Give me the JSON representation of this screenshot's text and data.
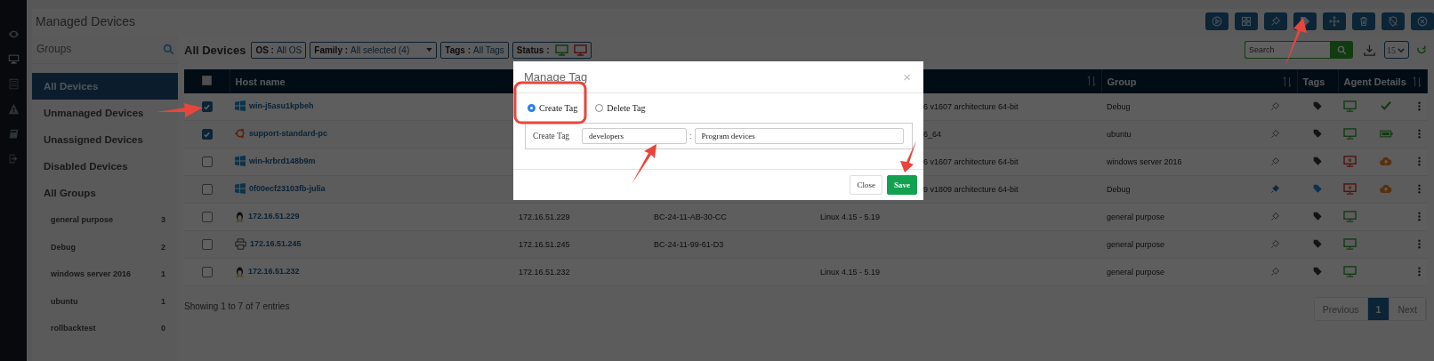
{
  "nav_rail": [
    {
      "kind": "eye",
      "selected": false
    },
    {
      "kind": "monitor",
      "selected": true
    },
    {
      "kind": "list",
      "selected": false
    },
    {
      "kind": "warning",
      "selected": false
    },
    {
      "kind": "book",
      "selected": false
    },
    {
      "kind": "logout",
      "selected": false
    }
  ],
  "page_title": "Managed Devices",
  "toolbar": [
    {
      "kind": "play"
    },
    {
      "kind": "grid"
    },
    {
      "kind": "pin"
    },
    {
      "kind": "tag"
    },
    {
      "kind": "move"
    },
    {
      "kind": "trash"
    },
    {
      "kind": "shield-off"
    },
    {
      "kind": "close-circle"
    }
  ],
  "groups_panel": {
    "title": "Groups",
    "items": [
      {
        "label": "All Devices",
        "selected": true
      },
      {
        "label": "Unmanaged Devices",
        "selected": false
      },
      {
        "label": "Unassigned Devices",
        "selected": false
      },
      {
        "label": "Disabled Devices",
        "selected": false
      },
      {
        "label": "All Groups",
        "selected": false
      }
    ],
    "groups": [
      {
        "name": "general purpose",
        "count": "3"
      },
      {
        "name": "Debug",
        "count": "2"
      },
      {
        "name": "windows server 2016",
        "count": "1"
      },
      {
        "name": "ubuntu",
        "count": "1"
      },
      {
        "name": "rollbacktest",
        "count": "0"
      }
    ]
  },
  "list_title": "All Devices",
  "filters": [
    {
      "kind": "plain",
      "label": "OS :",
      "value": "All OS"
    },
    {
      "kind": "dropdown",
      "label": "Family :",
      "value": "All selected (4)"
    },
    {
      "kind": "plain",
      "label": "Tags :",
      "value": "All Tags"
    },
    {
      "kind": "status",
      "label": "Status :"
    }
  ],
  "search": {
    "placeholder": "Search"
  },
  "page_size": "15",
  "table": {
    "columns": [
      "Host name",
      "Group",
      "Tags",
      "Agent Details"
    ],
    "select_all": {
      "checked": false
    },
    "rows": [
      {
        "checked": true,
        "os_icon": {
          "kind": "windows"
        },
        "host": "win-j5asu1kpbeh",
        "kind": "covered",
        "os": "6 v1607 architecture 64-bit",
        "group": "Debug",
        "pinned": false,
        "tagged": false,
        "online": true,
        "status": {
          "kind": "check"
        }
      },
      {
        "checked": true,
        "os_icon": {
          "kind": "ubuntu"
        },
        "host": "support-standard-pc",
        "kind": "covered",
        "os": "6_64",
        "group": "ubuntu",
        "pinned": false,
        "tagged": false,
        "online": true,
        "status": {
          "kind": "battery"
        }
      },
      {
        "checked": false,
        "os_icon": {
          "kind": "windows"
        },
        "host": "win-krbrd148b9m",
        "kind": "covered",
        "os": "6 v1607 architecture 64-bit",
        "group": "windows server 2016",
        "pinned": false,
        "tagged": false,
        "online": false,
        "status": {
          "kind": "upload"
        }
      },
      {
        "checked": false,
        "os_icon": {
          "kind": "windows"
        },
        "host": "0f00ecf23103fb-julia",
        "kind": "covered",
        "os": "9 v1809 architecture 64-bit",
        "group": "Debug",
        "pinned": true,
        "tagged": true,
        "online": false,
        "status": {
          "kind": "upload"
        }
      },
      {
        "checked": false,
        "os_icon": {
          "kind": "linux"
        },
        "host": "172.16.51.229",
        "kind": "full",
        "ip": "172.16.51.229",
        "mac": "BC-24-11-AB-30-CC",
        "os": "Linux 4.15 - 5.19",
        "group": "general purpose",
        "pinned": false,
        "tagged": false,
        "online": true
      },
      {
        "checked": false,
        "os_icon": {
          "kind": "printer"
        },
        "host": "172.16.51.245",
        "kind": "full",
        "ip": "172.16.51.245",
        "mac": "BC-24-11-99-61-D3",
        "group": "general purpose",
        "pinned": false,
        "tagged": false,
        "online": true
      },
      {
        "checked": false,
        "os_icon": {
          "kind": "linux"
        },
        "host": "172.16.51.232",
        "kind": "full",
        "ip": "172.16.51.232",
        "os": "Linux 4.15 - 5.19",
        "group": "general purpose",
        "pinned": false,
        "tagged": false,
        "online": true
      }
    ]
  },
  "footer": {
    "info": "Showing 1 to 7 of 7 entries",
    "pagination": [
      {
        "label": "Previous",
        "selected": false
      },
      {
        "label": "1",
        "selected": true
      },
      {
        "label": "Next",
        "selected": false
      }
    ]
  },
  "modal": {
    "title": "Manage Tag",
    "close_glyph": "×",
    "options": [
      {
        "label": "Create Tag",
        "selected": true
      },
      {
        "label": "Delete Tag",
        "selected": false
      }
    ],
    "field_label": "Create Tag",
    "tag_name": "developers",
    "separator": ":",
    "tag_value": "Program devices",
    "buttons": [
      {
        "label": "Close",
        "kind": "default"
      },
      {
        "label": "Save",
        "kind": "primary"
      }
    ]
  }
}
